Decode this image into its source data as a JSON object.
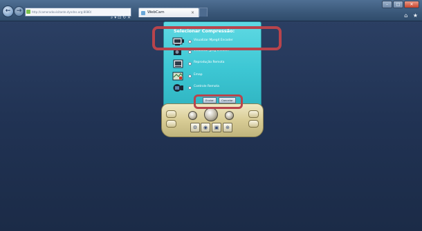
{
  "browser": {
    "url": "http://cameradovisitante.dyndns.org:8080/",
    "address_tools": "⌕ ▾ ⊡ ↻ ✕",
    "tab_title": "WebCam",
    "tab_close": "×"
  },
  "icons": {
    "back": "back-arrow-icon",
    "forward": "forward-arrow-icon",
    "home": "home-icon",
    "favorites": "star-icon"
  },
  "colors": {
    "page_background": "#1e2a44",
    "screen": "#3dc7d4",
    "highlight": "#b8444c"
  },
  "webcam": {
    "title": "Selecionar Compressão:",
    "options": [
      {
        "label": "Visualizar Mpeg4 Encoder",
        "icon": "camera-viewer-icon"
      },
      {
        "label": "Visualizar Jpeg Encoder",
        "icon": "device-icon"
      },
      {
        "label": "Reprodução Remota",
        "icon": "playback-icon"
      },
      {
        "label": "Emap",
        "icon": "map-icon"
      },
      {
        "label": "Controle Remota",
        "icon": "remote-control-icon"
      }
    ],
    "send_label": "Enviar",
    "cancel_label": "Cancelar",
    "control_icons": [
      "settings-icon",
      "camera-icon",
      "network-icon",
      "zoom-icon"
    ]
  }
}
